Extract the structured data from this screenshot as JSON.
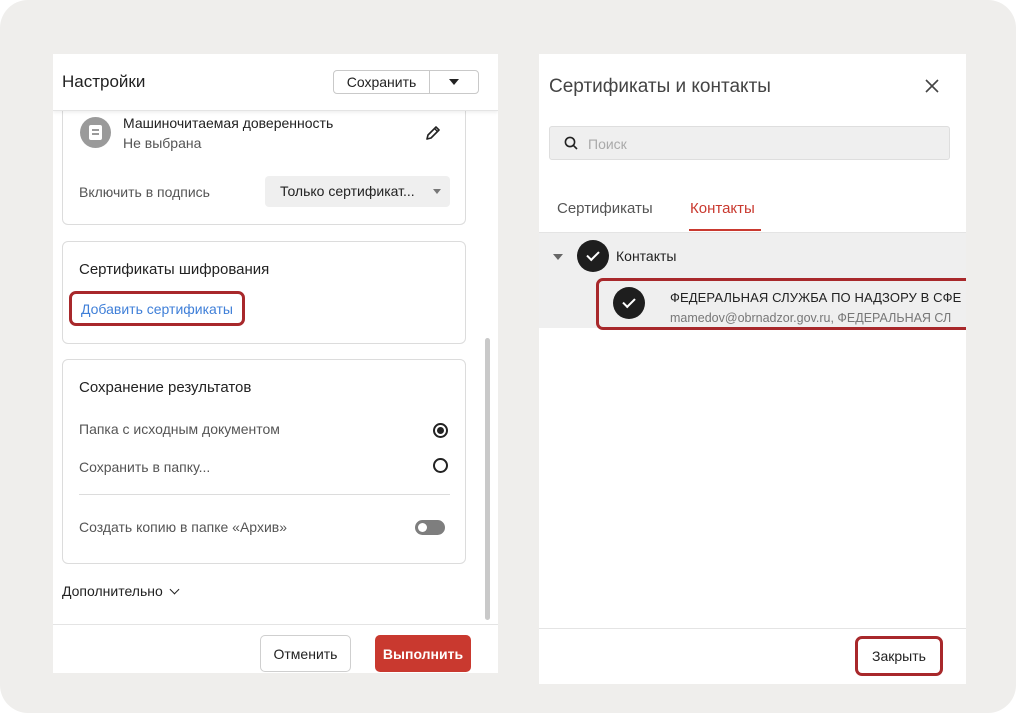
{
  "settings": {
    "title": "Настройки",
    "save_label": "Сохранить",
    "mrd": {
      "title": "Машиночитаемая доверенность",
      "value": "Не выбрана"
    },
    "include_label": "Включить в подпись",
    "include_value": "Только сертификат...",
    "encryption": {
      "heading": "Сертификаты шифрования",
      "add_link": "Добавить сертификаты"
    },
    "results": {
      "heading": "Сохранение результатов",
      "option_source": "Папка с исходным документом",
      "option_folder": "Сохранить в папку...",
      "selected": "option_source",
      "archive_copy": "Создать копию в папке «Архив»",
      "archive_enabled": false
    },
    "more_label": "Дополнительно",
    "cancel_label": "Отменить",
    "run_label": "Выполнить"
  },
  "contacts_dialog": {
    "title": "Сертификаты и контакты",
    "search_placeholder": "Поиск",
    "tabs": [
      {
        "label": "Сертификаты",
        "active": false
      },
      {
        "label": "Контакты",
        "active": true
      }
    ],
    "group": {
      "label": "Контакты",
      "checked": true
    },
    "contact": {
      "name": "ФЕДЕРАЛЬНАЯ СЛУЖБА ПО НАДЗОРУ В СФЕ",
      "details": "mamedov@obrnadzor.gov.ru, ФЕДЕРАЛЬНАЯ СЛ",
      "checked": true
    },
    "close_label": "Закрыть"
  },
  "colors": {
    "accent": "#c9392f",
    "highlight_border": "#a8282b",
    "link": "#3f7fd8"
  }
}
